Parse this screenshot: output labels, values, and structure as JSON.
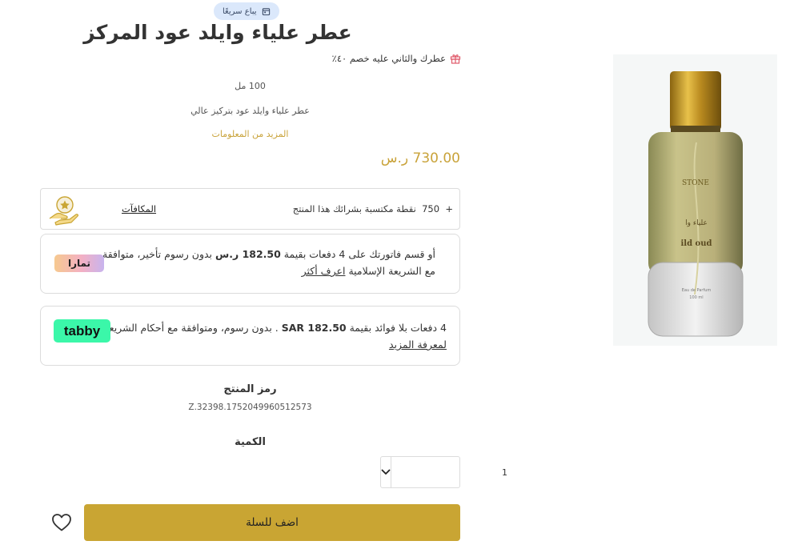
{
  "badge": {
    "label": "يباع سريعًا",
    "icon": "calendar-icon"
  },
  "product": {
    "title": "عطر علياء وايلد عود المركز",
    "offer_text": "عطرك والثاني عليه خصم ٤٠٪",
    "offer_icon": "gift-icon",
    "size": "100 مل",
    "description": "عطر علياء وايلد عود بتركيز عالي",
    "more_info": "المزيد من المعلومات",
    "price": "730.00 ر.س",
    "image_alt": "عطر علياء وايلد عود المركز"
  },
  "rewards": {
    "points_prefix": "+",
    "points": "750",
    "text": "نقطة مكتسبة بشرائك هذا المنتج",
    "link": "المكافآت",
    "icon": "hand-star-icon"
  },
  "tamara": {
    "text_before": "أو قسم فاتورتك على 4 دفعات بقيمة",
    "amount": "182.50 ر.س",
    "text_after": "بدون رسوم تأخير، متوافقة مع الشريعة الإسلامية",
    "link": "اعرف أكثر",
    "logo": "تمارا"
  },
  "tabby": {
    "text_before": "4 دفعات بلا فوائد بقيمة",
    "amount": "SAR 182.50",
    "text_after": ". بدون رسوم، ومتوافقة مع أحكام الشريعة.",
    "link": "لمعرفة المزيد",
    "logo": "tabby"
  },
  "sku": {
    "label": "رمز المنتج",
    "value": "Z.32398.1752049960512573"
  },
  "quantity": {
    "label": "الكمية",
    "value": "1",
    "chevron_icon": "chevron-down-icon"
  },
  "actions": {
    "add_to_cart": "اضف للسلة",
    "wishlist_icon": "heart-icon"
  },
  "image": {
    "brand_text": "STONE",
    "label_ar": "علياء وا",
    "label_en": "ild oud",
    "label_small_1": "Eau de Parfum",
    "label_small_2": "100 ml"
  },
  "colors": {
    "accent": "#c9a533",
    "price": "#c9a33a",
    "badge_bg": "#dbe8fb",
    "tabby": "#3bf7a9"
  }
}
